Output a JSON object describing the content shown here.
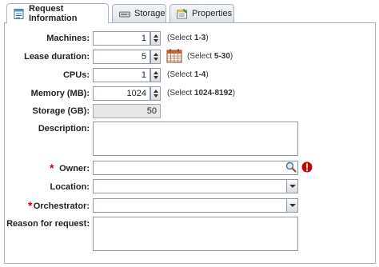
{
  "tabs": [
    {
      "label": "Request Information",
      "icon": "form-icon",
      "active": true
    },
    {
      "label": "Storage",
      "icon": "disk-icon",
      "active": false
    },
    {
      "label": "Properties",
      "icon": "properties-icon",
      "active": false
    }
  ],
  "form": {
    "machines": {
      "label": "Machines:",
      "value": "1",
      "hint_prefix": "(Select ",
      "hint_range": "1-3",
      "hint_suffix": ")"
    },
    "lease": {
      "label": "Lease duration:",
      "value": "5",
      "hint_prefix": "(Select ",
      "hint_range": "5-30",
      "hint_suffix": ")"
    },
    "cpus": {
      "label": "CPUs:",
      "value": "1",
      "hint_prefix": "(Select ",
      "hint_range": "1-4",
      "hint_suffix": ")"
    },
    "memory": {
      "label": "Memory (MB):",
      "value": "1024",
      "hint_prefix": "(Select ",
      "hint_range": "1024-8192",
      "hint_suffix": ")"
    },
    "storage": {
      "label": "Storage (GB):",
      "value": "50"
    },
    "description": {
      "label": "Description:",
      "value": ""
    },
    "owner": {
      "label": "Owner:",
      "value": "",
      "required": "*"
    },
    "location": {
      "label": "Location:",
      "value": ""
    },
    "orchestrator": {
      "label": "Orchestrator:",
      "value": "",
      "required": "*"
    },
    "reason": {
      "label": "Reason for request:",
      "value": ""
    }
  },
  "colors": {
    "required": "#cc0000",
    "error": "#d00000",
    "border": "#8e9aab"
  }
}
